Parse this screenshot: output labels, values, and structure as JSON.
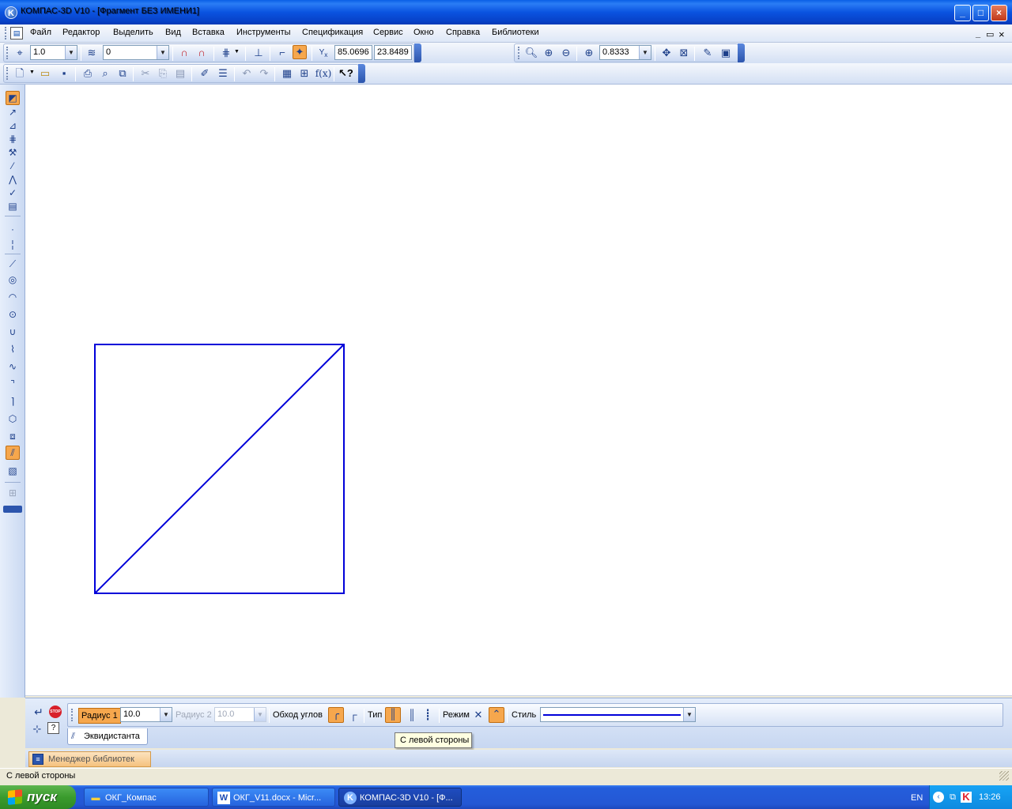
{
  "window": {
    "title": "КОМПАС-3D V10 - [Фрагмент БЕЗ ИМЕНИ1]",
    "controls": [
      "minimize-icon",
      "maximize-icon",
      "close-icon"
    ]
  },
  "menu": {
    "items": [
      "Файл",
      "Редактор",
      "Выделить",
      "Вид",
      "Вставка",
      "Инструменты",
      "Спецификация",
      "Сервис",
      "Окно",
      "Справка",
      "Библиотеки"
    ],
    "doc_controls": [
      "_",
      "▭",
      "×"
    ]
  },
  "toolbar_current_state": {
    "step": "1.0",
    "layer": "0",
    "coord_x": "85.0696",
    "coord_y": "23.8489"
  },
  "toolbar_view": {
    "zoom": "0.8333"
  },
  "toolbar_standard": {
    "icons": [
      "new-icon",
      "open-icon",
      "save-icon",
      "print-icon",
      "preview-icon",
      "cut-icon",
      "copy-icon",
      "paste-icon",
      "properties-icon",
      "undo-icon",
      "redo-icon",
      "variables-icon",
      "help-icon"
    ],
    "fx_label": "f(x)"
  },
  "left_panel": {
    "icons": [
      "geometry-icon",
      "dimensions-icon",
      "designations-icon",
      "editing-icon",
      "parametrization-icon",
      "measure-icon",
      "selection-icon",
      "associative-icon",
      "spec-icon",
      "point-icon",
      "auxiliary-line-icon",
      "segment-icon",
      "circle-icon",
      "arc-icon",
      "ellipse-icon",
      "continuous-input-icon",
      "polyline-icon",
      "bezier-icon",
      "chamfer-icon",
      "fillet-icon",
      "polygon-icon",
      "collection-icon",
      "equidistant-icon",
      "hatch-icon",
      "macro-icon"
    ]
  },
  "property_panel": {
    "radius1_label": "Радиус 1",
    "radius1_value": "10.0",
    "radius2_label": "Радиус 2",
    "radius2_value": "10.0",
    "corner_label": "Обход углов",
    "type_label": "Тип",
    "mode_label": "Режим",
    "style_label": "Стиль",
    "tab_label": "Эквидистанта",
    "tooltip": "С левой стороны"
  },
  "library_manager": {
    "label": "Менеджер библиотек"
  },
  "status": {
    "text": "С левой стороны"
  },
  "taskbar": {
    "start_label": "пуск",
    "tasks": [
      {
        "label": "ОКГ_Компас",
        "icon": "folder-icon",
        "active": false
      },
      {
        "label": "ОКГ_V11.docx - Micr...",
        "icon": "word-icon",
        "active": false
      },
      {
        "label": "КОМПАС-3D V10 - [Ф...",
        "icon": "kompas-icon",
        "active": true
      }
    ],
    "lang": "EN",
    "time": "13:26"
  },
  "drawing": {
    "line_color": "#0000D9",
    "shapes": [
      "square",
      "diagonal"
    ]
  }
}
